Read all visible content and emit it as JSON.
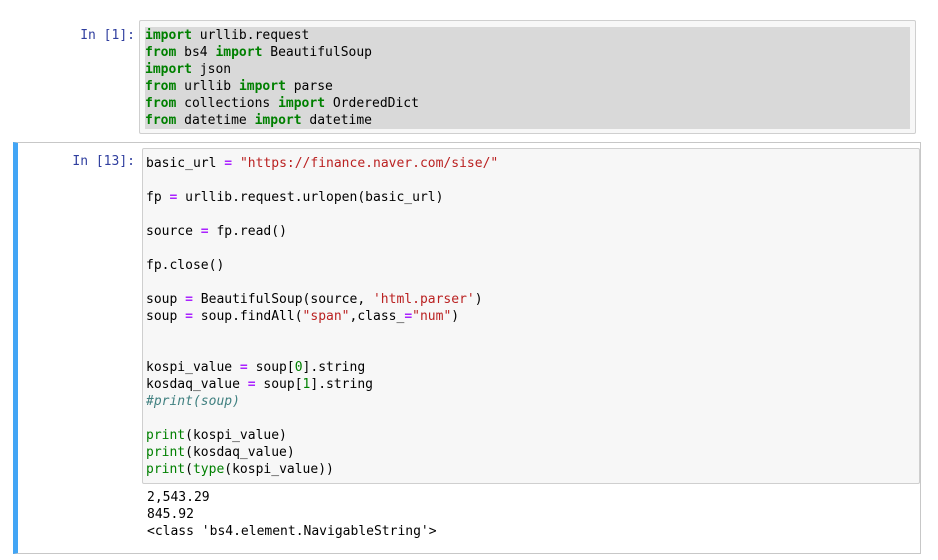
{
  "cell1": {
    "prompt": "In [1]:",
    "code_lines": [
      "import urllib.request",
      "from bs4 import BeautifulSoup",
      "import json",
      "from urllib import parse",
      "from collections import OrderedDict",
      "from datetime import datetime"
    ]
  },
  "cell2": {
    "prompt": "In [13]:",
    "code_lines": [
      "basic_url = \"https://finance.naver.com/sise/\"",
      "",
      "fp = urllib.request.urlopen(basic_url)",
      "",
      "source = fp.read()",
      "",
      "fp.close()",
      "",
      "soup = BeautifulSoup(source, 'html.parser')",
      "soup = soup.findAll(\"span\",class_=\"num\")",
      "",
      "",
      "kospi_value = soup[0].string",
      "kosdaq_value = soup[1].string",
      "#print(soup)",
      "",
      "print(kospi_value)",
      "print(kosdaq_value)",
      "print(type(kospi_value))"
    ],
    "output_lines": [
      "2,543.29",
      "845.92",
      "<class 'bs4.element.NavigableString'>"
    ]
  },
  "colors": {
    "prompt": "#303f9f",
    "selected_cell_border": "#42a5f5",
    "keyword": "#008000",
    "string": "#ba2121",
    "comment": "#408080",
    "operator": "#aa22ff"
  }
}
